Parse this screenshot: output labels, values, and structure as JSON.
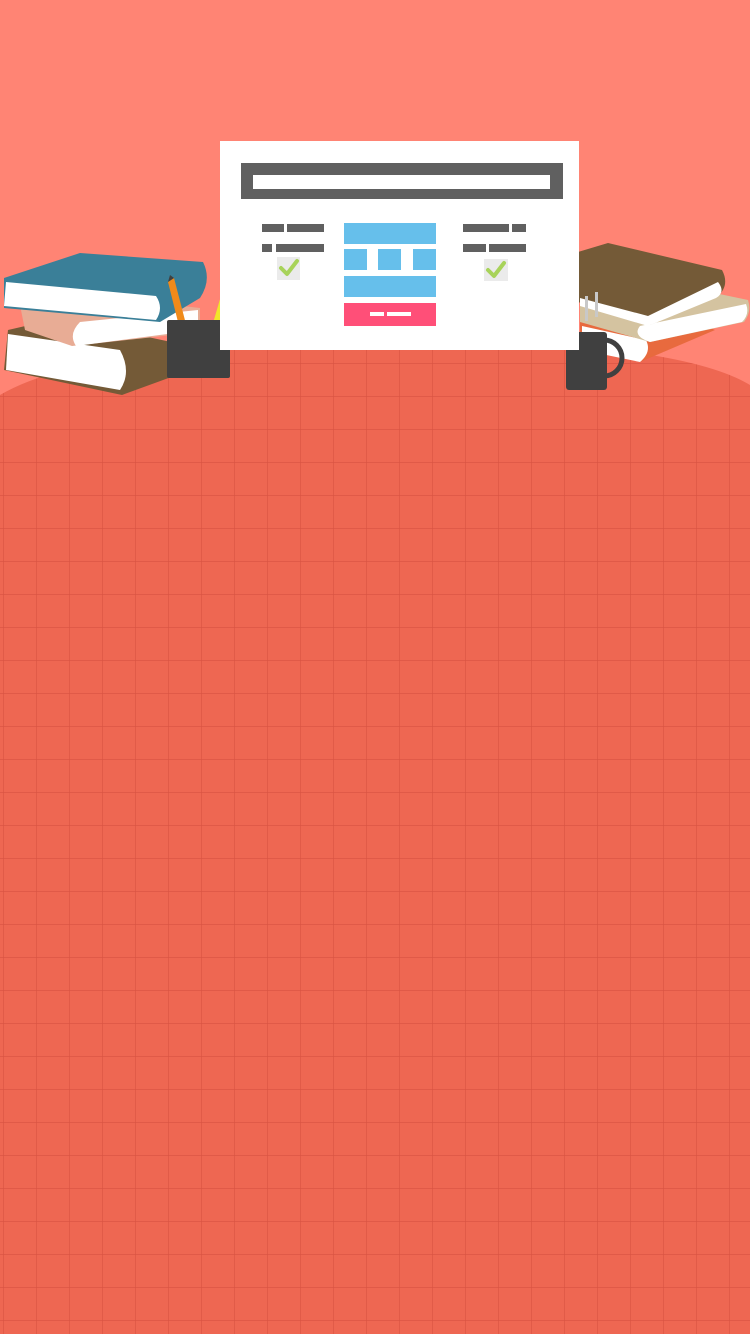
{
  "scene": {
    "name": "study-desk-illustration",
    "colors": {
      "sky": "#FF8474",
      "desk": "#EE6752",
      "grid_line": "#CF4A3B",
      "frame_dark": "#606060",
      "panel_white": "#FFFFFF",
      "tile_blue": "#66BFEB",
      "button_pink": "#FF4F78",
      "check_green": "#A8D35A",
      "check_box": "#EBEBEB",
      "book_teal": "#3A7F98",
      "book_peach": "#E8AC95",
      "book_brown": "#745A37",
      "book_tan": "#D4C3A0",
      "book_orange_spine": "#E86A3E",
      "pages_white": "#FFFFFF",
      "cup_dark": "#404040",
      "pencil_orange": "#F08A1A",
      "pencil_yellow": "#F2E52A",
      "steam_gray": "#C8C8C8"
    },
    "icons": [
      "checkmark-icon",
      "pencil-icon",
      "steam-icon"
    ]
  }
}
